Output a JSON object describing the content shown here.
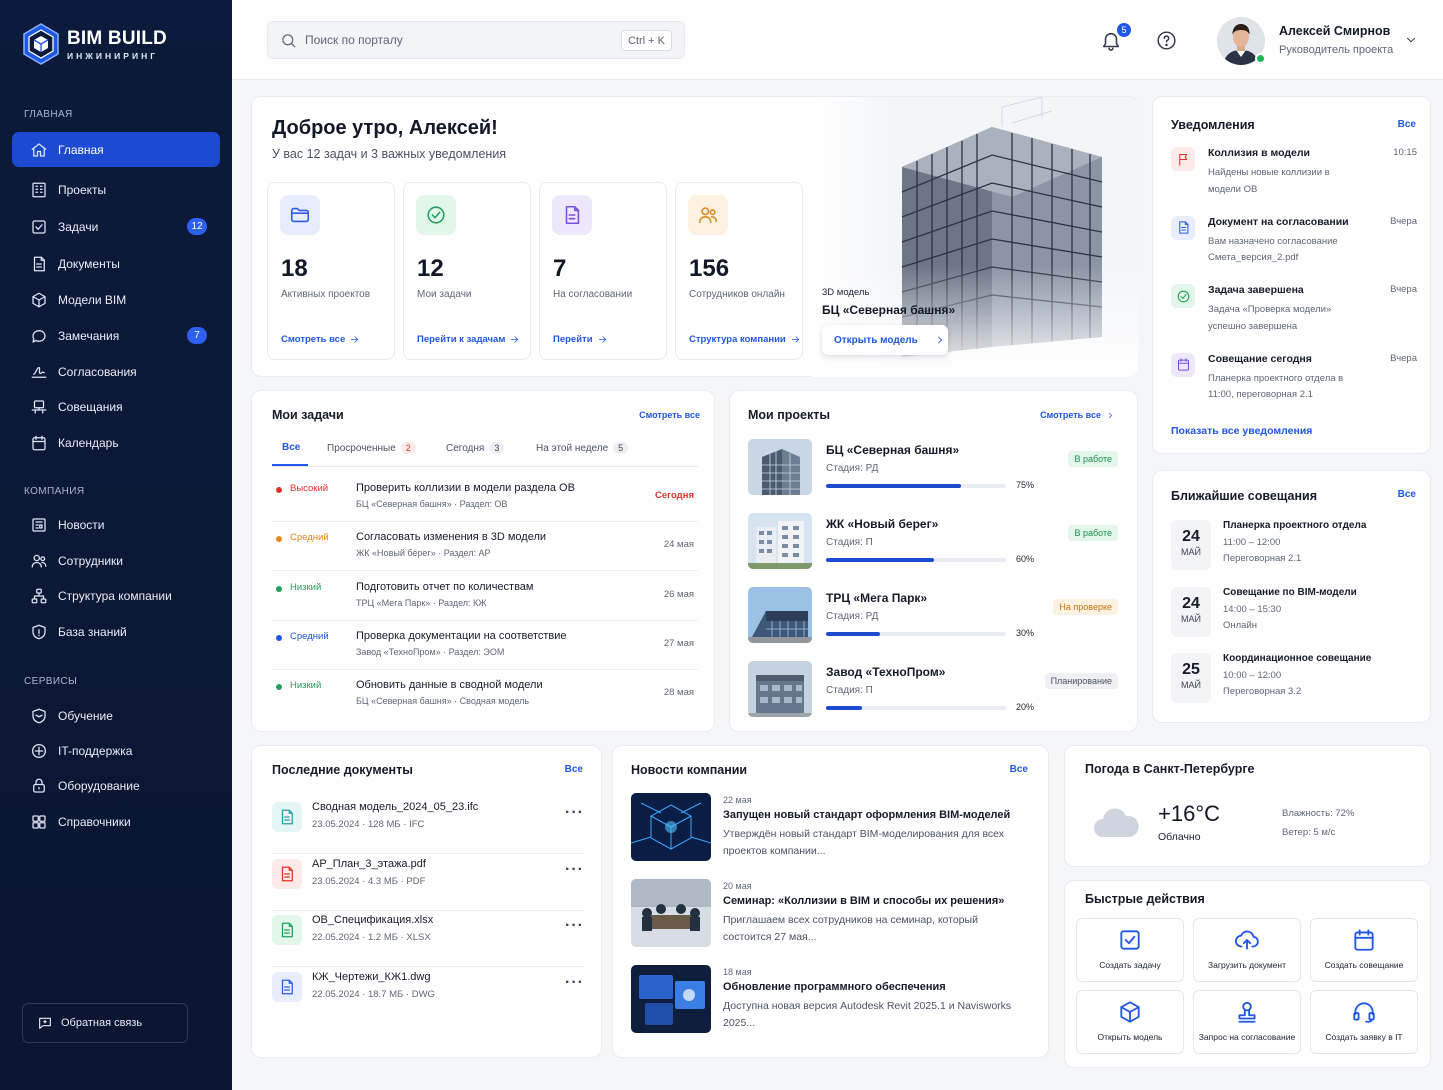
{
  "brand": {
    "title": "BIM BUILD",
    "subtitle": "ИНЖИНИРИНГ"
  },
  "sidebar": {
    "sections": {
      "main": "ГЛАВНАЯ",
      "company": "КОМПАНИЯ",
      "services": "СЕРВИСЫ"
    },
    "main_items": [
      {
        "label": "Главная",
        "icon": "home-icon"
      },
      {
        "label": "Проекты",
        "icon": "building-icon"
      },
      {
        "label": "Задачи",
        "icon": "task-icon",
        "badge": "12"
      },
      {
        "label": "Документы",
        "icon": "document-icon"
      },
      {
        "label": "Модели BIM",
        "icon": "cube-icon"
      },
      {
        "label": "Замечания",
        "icon": "comment-icon",
        "badge": "7"
      },
      {
        "label": "Согласования",
        "icon": "signature-icon"
      },
      {
        "label": "Совещания",
        "icon": "meeting-icon"
      },
      {
        "label": "Календарь",
        "icon": "calendar-icon"
      }
    ],
    "company_items": [
      {
        "label": "Новости",
        "icon": "news-icon"
      },
      {
        "label": "Сотрудники",
        "icon": "users-icon"
      },
      {
        "label": "Структура компании",
        "icon": "org-structure-icon"
      },
      {
        "label": "База знаний",
        "icon": "knowledge-icon"
      }
    ],
    "service_items": [
      {
        "label": "Обучение",
        "icon": "education-icon"
      },
      {
        "label": "IT-поддержка",
        "icon": "support-icon"
      },
      {
        "label": "Оборудование",
        "icon": "equipment-icon"
      },
      {
        "label": "Справочники",
        "icon": "directory-icon"
      }
    ],
    "feedback": "Обратная связь"
  },
  "topbar": {
    "search_placeholder": "Поиск по порталу",
    "search_shortcut": "Ctrl + K",
    "notifications_count": "5",
    "user_name": "Алексей Смирнов",
    "user_role": "Руководитель проекта"
  },
  "hero": {
    "greeting": "Доброе утро, Алексей!",
    "subtitle": "У вас 12 задач и 3 важных уведомления",
    "stats": [
      {
        "value": "18",
        "label": "Активных проектов",
        "link": "Смотреть все",
        "icon": "folder-icon",
        "color": "#2e5be8",
        "bg": "#e7edfd"
      },
      {
        "value": "12",
        "label": "Мои задачи",
        "link": "Перейти к задачам",
        "icon": "check-circle-icon",
        "color": "#21a35a",
        "bg": "#e3f6ea"
      },
      {
        "value": "7",
        "label": "На согласовании",
        "link": "Перейти",
        "icon": "file-icon",
        "color": "#7a4fe0",
        "bg": "#eee8fc"
      },
      {
        "value": "156",
        "label": "Сотрудников онлайн",
        "link": "Структура компании",
        "icon": "users-icon",
        "color": "#e08a1e",
        "bg": "#fdf1e1"
      }
    ],
    "model_label": "3D модель",
    "model_name": "БЦ «Северная башня»",
    "model_button": "Открыть модель"
  },
  "tasks": {
    "title": "Мои задачи",
    "link": "Смотреть все",
    "tabs": [
      {
        "label": "Все"
      },
      {
        "label": "Просроченные",
        "count": "2"
      },
      {
        "label": "Сегодня",
        "count": "3"
      },
      {
        "label": "На этой неделе",
        "count": "5"
      }
    ],
    "rows": [
      {
        "priority": "Высокий",
        "color": "#e0342b",
        "name": "Проверить коллизии в модели раздела ОВ",
        "meta": "БЦ «Северная башня» · Раздел: ОВ",
        "date": "Сегодня"
      },
      {
        "priority": "Средний",
        "color": "#e5891a",
        "name": "Согласовать изменения в 3D модели",
        "meta": "ЖК «Новый берег» · Раздел: АР",
        "date": "24 мая"
      },
      {
        "priority": "Низкий",
        "color": "#21a35a",
        "name": "Подготовить отчет по количествам",
        "meta": "ТРЦ «Мега Парк» · Раздел: КЖ",
        "date": "26 мая"
      },
      {
        "priority": "Средний",
        "color": "#1f57e6",
        "name": "Проверка документации на соответствие",
        "meta": "Завод «ТехноПром» · Раздел: ЭОМ",
        "date": "27 мая"
      },
      {
        "priority": "Низкий",
        "color": "#21a35a",
        "name": "Обновить данные в сводной модели",
        "meta": "БЦ «Северная башня» · Сводная модель",
        "date": "28 мая"
      }
    ]
  },
  "projects": {
    "title": "Мои проекты",
    "link": "Смотреть все",
    "rows": [
      {
        "name": "БЦ «Северная башня»",
        "stage": "Стадия: РД",
        "progress": 75,
        "pct": "75%",
        "status": "В работе",
        "status_color": "#1e8f4c",
        "status_bg": "#e3f6ea"
      },
      {
        "name": "ЖК «Новый берег»",
        "stage": "Стадия: П",
        "progress": 60,
        "pct": "60%",
        "status": "В работе",
        "status_color": "#1e8f4c",
        "status_bg": "#e3f6ea"
      },
      {
        "name": "ТРЦ «Мега Парк»",
        "stage": "Стадия: РД",
        "progress": 30,
        "pct": "30%",
        "status": "На проверке",
        "status_color": "#c9760e",
        "status_bg": "#fdf1e1"
      },
      {
        "name": "Завод «ТехноПром»",
        "stage": "Стадия: П",
        "progress": 20,
        "pct": "20%",
        "status": "Планирование",
        "status_color": "#4b5366",
        "status_bg": "#eef0f4"
      }
    ]
  },
  "notifications": {
    "title": "Уведомления",
    "link": "Все",
    "items": [
      {
        "title": "Коллизия в модели",
        "text": "Найдены новые коллизии в модели ОВ",
        "time": "10:15",
        "icon": "flag-icon",
        "color": "#e0342b",
        "bg": "#fde9e8"
      },
      {
        "title": "Документ на согласовании",
        "text": "Вам назначено согласование Смета_версия_2.pdf",
        "time": "Вчера",
        "icon": "file-icon",
        "color": "#2e5be8",
        "bg": "#e7edfd"
      },
      {
        "title": "Задача завершена",
        "text": "Задача «Проверка модели» успешно завершена",
        "time": "Вчера",
        "icon": "check-circle-icon",
        "color": "#21a35a",
        "bg": "#e3f6ea"
      },
      {
        "title": "Совещание сегодня",
        "text": "Планерка проектного отдела в 11:00, переговорная 2.1",
        "time": "Вчера",
        "icon": "calendar-icon",
        "color": "#7a4fe0",
        "bg": "#eee8fc"
      }
    ],
    "show_all": "Показать все уведомления"
  },
  "meetings": {
    "title": "Ближайшие совещания",
    "link": "Все",
    "items": [
      {
        "day": "24",
        "month": "МАЙ",
        "title": "Планерка проектного отдела",
        "time": "11:00 – 12:00",
        "room": "Переговорная 2.1"
      },
      {
        "day": "24",
        "month": "МАЙ",
        "title": "Совещание по BIM-модели",
        "time": "14:00 – 15:30",
        "room": "Онлайн"
      },
      {
        "day": "25",
        "month": "МАЙ",
        "title": "Координационное совещание",
        "time": "10:00 – 12:00",
        "room": "Переговорная 3.2"
      }
    ]
  },
  "documents": {
    "title": "Последние документы",
    "link": "Все",
    "items": [
      {
        "name": "Сводная модель_2024_05_23.ifc",
        "meta": "23.05.2024 · 128 МБ · IFC",
        "color": "#2aa0a8",
        "bg": "#e4f5f6"
      },
      {
        "name": "АР_План_3_этажа.pdf",
        "meta": "23.05.2024 · 4.3 МБ · PDF",
        "color": "#e0342b",
        "bg": "#fde9e8"
      },
      {
        "name": "ОВ_Спецификация.xlsx",
        "meta": "22.05.2024 · 1.2 МБ · XLSX",
        "color": "#21a35a",
        "bg": "#e3f6ea"
      },
      {
        "name": "КЖ_Чертежи_КЖ1.dwg",
        "meta": "22.05.2024 · 18.7 МБ · DWG",
        "color": "#2e5be8",
        "bg": "#e7edfd"
      }
    ]
  },
  "news": {
    "title": "Новости компании",
    "link": "Все",
    "items": [
      {
        "date": "22 мая",
        "title": "Запущен новый стандарт оформления BIM-моделей",
        "text": "Утверждён новый стандарт BIM-моделирования для всех проектов компании..."
      },
      {
        "date": "20 мая",
        "title": "Семинар: «Коллизии в BIM и способы их решения»",
        "text": "Приглашаем всех сотрудников на семинар, который состоится 27 мая..."
      },
      {
        "date": "18 мая",
        "title": "Обновление программного обеспечения",
        "text": "Доступна новая версия Autodesk Revit 2025.1 и Navisworks 2025..."
      }
    ]
  },
  "weather": {
    "title": "Погода в Санкт-Петербурге",
    "temp": "+16°C",
    "desc": "Облачно",
    "humidity": "Влажность: 72%",
    "wind": "Ветер: 5 м/с"
  },
  "quick_actions": {
    "title": "Быстрые действия",
    "items": [
      {
        "label": "Создать задачу",
        "icon": "task-check-icon"
      },
      {
        "label": "Загрузить документ",
        "icon": "cloud-upload-icon"
      },
      {
        "label": "Создать совещание",
        "icon": "calendar-icon"
      },
      {
        "label": "Открыть модель",
        "icon": "cube-icon"
      },
      {
        "label": "Запрос на согласование",
        "icon": "stamp-icon"
      },
      {
        "label": "Создать заявку в IT",
        "icon": "headset-icon"
      }
    ]
  }
}
